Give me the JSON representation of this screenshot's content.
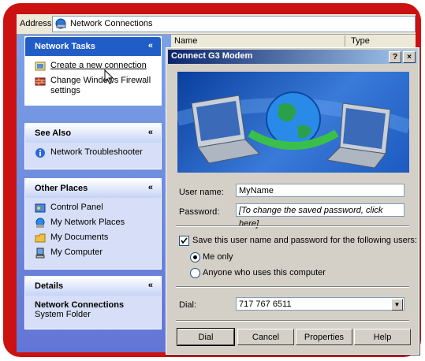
{
  "address": {
    "label": "Address",
    "value": "Network Connections"
  },
  "columns": {
    "name": "Name",
    "type": "Type"
  },
  "panels": {
    "network_tasks": {
      "title": "Network Tasks",
      "items": [
        "Create a new connection",
        "Change Windows Firewall settings"
      ]
    },
    "see_also": {
      "title": "See Also",
      "items": [
        "Network Troubleshooter"
      ]
    },
    "other_places": {
      "title": "Other Places",
      "items": [
        "Control Panel",
        "My Network Places",
        "My Documents",
        "My Computer"
      ]
    },
    "details": {
      "title": "Details",
      "name": "Network Connections",
      "type": "System Folder"
    }
  },
  "dialog": {
    "title": "Connect G3 Modem",
    "help_btn": "?",
    "close_btn": "×",
    "user_name_label": "User name:",
    "user_name_value": "MyName",
    "password_label": "Password:",
    "password_value": "[To change the saved password, click here]",
    "save_label": "Save this user name and password for the following users:",
    "save_checked": true,
    "radio_me": "Me only",
    "radio_anyone": "Anyone who uses this computer",
    "radio_selected": "me",
    "dial_label": "Dial:",
    "dial_value": "717 767 6511",
    "buttons": {
      "dial": "Dial",
      "cancel": "Cancel",
      "properties": "Properties",
      "help": "Help"
    }
  },
  "colors": {
    "frame": "#cc1111",
    "title_bar": "#0a246a",
    "panel_head": "#215dc6"
  }
}
